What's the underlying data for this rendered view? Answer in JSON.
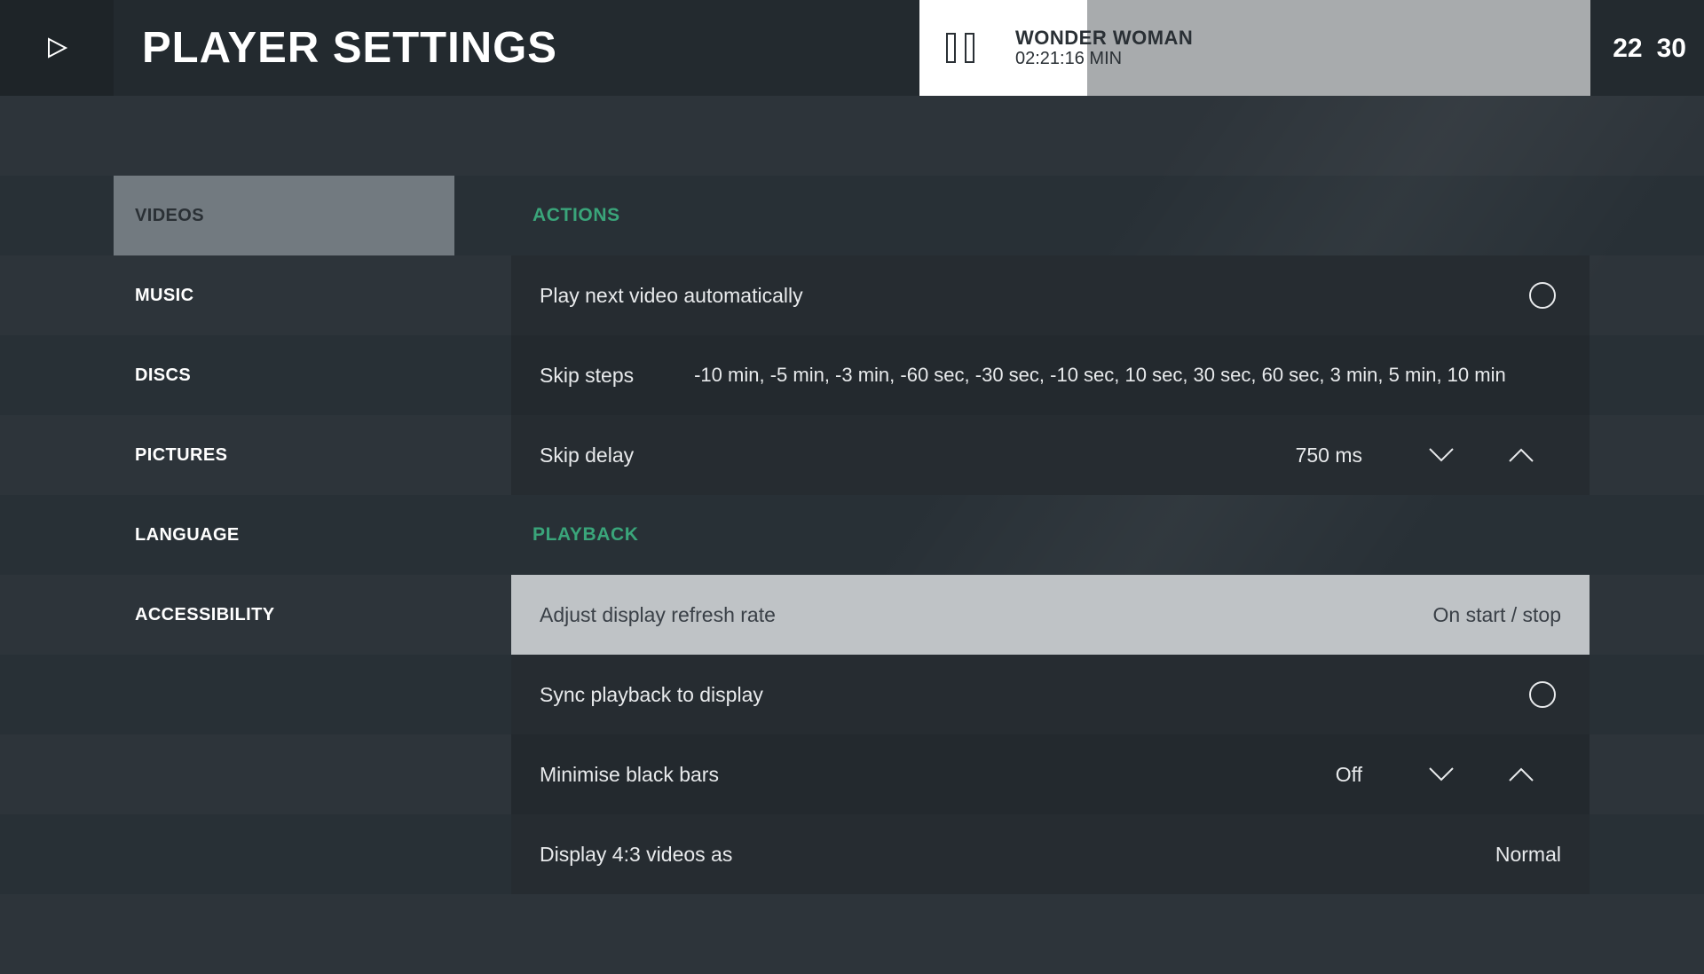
{
  "header": {
    "title": "PLAYER SETTINGS",
    "now_playing": {
      "title": "WONDER WOMAN",
      "time": "02:21:16 MIN",
      "progress": 0.25
    },
    "clock": {
      "hours": "22",
      "minutes": "30"
    }
  },
  "sidebar": {
    "items": [
      {
        "label": "VIDEOS",
        "active": true
      },
      {
        "label": "MUSIC"
      },
      {
        "label": "DISCS"
      },
      {
        "label": "PICTURES"
      },
      {
        "label": "LANGUAGE"
      },
      {
        "label": "ACCESSIBILITY"
      }
    ]
  },
  "sections": {
    "actions": {
      "heading": "ACTIONS",
      "play_next": {
        "label": "Play next video automatically",
        "checked": false
      },
      "skip_steps": {
        "label": "Skip steps",
        "value": "-10 min, -5 min, -3 min, -60 sec, -30 sec, -10 sec, 10 sec, 30 sec, 60 sec, 3 min, 5 min, 10 min"
      },
      "skip_delay": {
        "label": "Skip delay",
        "value": "750 ms"
      }
    },
    "playback": {
      "heading": "PLAYBACK",
      "refresh_rate": {
        "label": "Adjust display refresh rate",
        "value": "On start / stop"
      },
      "sync": {
        "label": "Sync playback to display",
        "checked": false
      },
      "black_bars": {
        "label": "Minimise black bars",
        "value": "Off"
      },
      "four_three": {
        "label": "Display 4:3 videos as",
        "value": "Normal"
      }
    }
  },
  "colors": {
    "accent": "#3aa57a",
    "header_bg": "#232a2f",
    "focus_bg": "#bfc3c6",
    "active_tab_bg": "#727a80"
  },
  "icons": {
    "home": "play-triangle-icon",
    "pause": "pause-icon",
    "radio": "radio-circle-icon",
    "down": "chevron-down-icon",
    "up": "chevron-up-icon"
  }
}
